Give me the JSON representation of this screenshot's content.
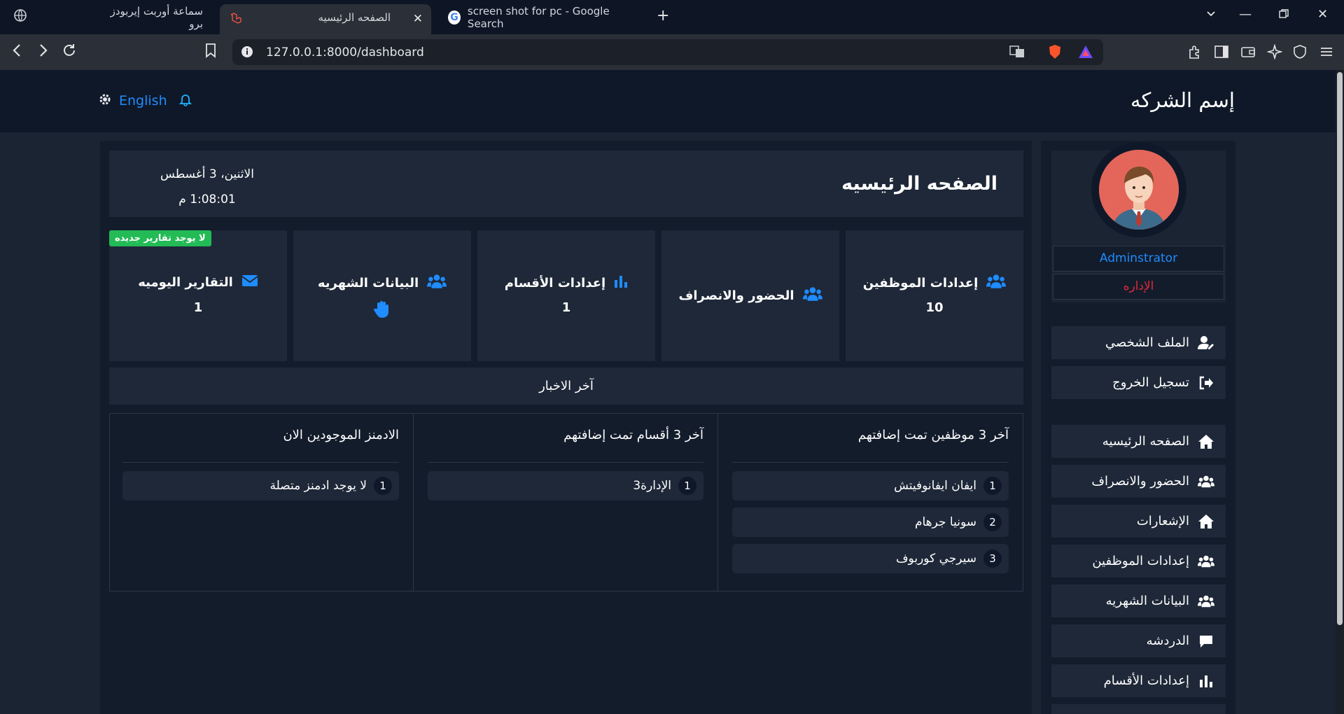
{
  "browser": {
    "tabs": [
      {
        "title": "سماعة أوربت إيربودز برو",
        "active": false
      },
      {
        "title": "الصفحه الرئيسيه",
        "active": true
      },
      {
        "title": "screen shot for pc - Google Search",
        "active": false
      }
    ],
    "url": "127.0.0.1:8000/dashboard"
  },
  "navbar": {
    "brand": "إسم الشركه",
    "language": "English"
  },
  "sidebar": {
    "username": "Adminstrator",
    "department": "الإداره",
    "account_items": [
      {
        "label": "الملف الشخصي",
        "icon": "user-edit-icon"
      },
      {
        "label": "تسجيل الخروج",
        "icon": "sign-out-icon"
      }
    ],
    "menu_items": [
      {
        "label": "الصفحه الرئيسيه",
        "icon": "home-icon"
      },
      {
        "label": "الحضور والانصراف",
        "icon": "users-icon"
      },
      {
        "label": "الإشعارات",
        "icon": "home-icon"
      },
      {
        "label": "إعدادات الموظفين",
        "icon": "users-icon"
      },
      {
        "label": "البيانات الشهريه",
        "icon": "users-icon"
      },
      {
        "label": "الدردشه",
        "icon": "chat-icon"
      },
      {
        "label": "إعدادات الأقسام",
        "icon": "bar-chart-icon"
      }
    ]
  },
  "header": {
    "title": "الصفحه الرئيسيه",
    "date": "الاثنين، 3 أغسطس",
    "time": "1:08:01 م"
  },
  "stats": [
    {
      "label": "إعدادات الموظفين",
      "value": "10",
      "icon": "users-icon"
    },
    {
      "label": "الحضور والانصراف",
      "value": "",
      "icon": "users-icon"
    },
    {
      "label": "إعدادات الأقسام",
      "value": "1",
      "icon": "bar-chart-icon"
    },
    {
      "label": "البيانات الشهريه",
      "value": "",
      "icon": "users-icon"
    },
    {
      "label": "التقارير اليوميه",
      "value": "1",
      "icon": "envelope-icon",
      "badge": "لا يوجد تقارير جديده"
    }
  ],
  "news": {
    "title": "آخر الاخبار",
    "columns": [
      {
        "title": "آخر 3 موظفين تمت إضافتهم",
        "items": [
          {
            "n": "1",
            "text": "ايفان ايفانوفيتش"
          },
          {
            "n": "2",
            "text": "سونيا جرهام"
          },
          {
            "n": "3",
            "text": "سيرجي كوربوف"
          }
        ]
      },
      {
        "title": "آخر 3 أقسام تمت إضافتهم",
        "items": [
          {
            "n": "1",
            "text": "الإدارة3"
          }
        ]
      },
      {
        "title": "الادمنز الموجودين الان",
        "items": [
          {
            "n": "1",
            "text": "لا يوجد ادمنز متصلة"
          }
        ]
      }
    ]
  },
  "colors": {
    "accent": "#1f8cff",
    "danger": "#e0283a",
    "success": "#22bb55",
    "navbar": "#0f1828",
    "card": "#1e2838"
  }
}
